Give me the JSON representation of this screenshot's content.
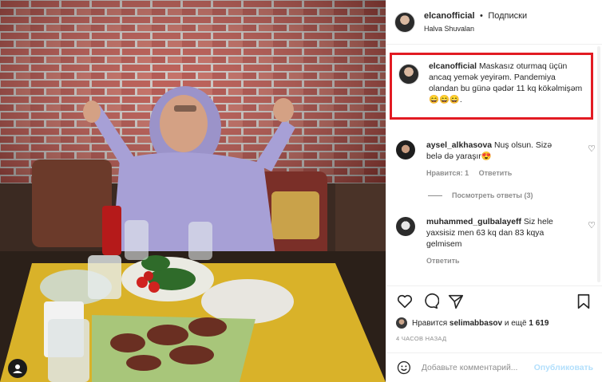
{
  "post": {
    "username": "elcanofficial",
    "separator": "•",
    "follow_label": "Подписки",
    "location": "Halva Shuvalan"
  },
  "caption": {
    "username": "elcanofficial",
    "text": "Maskasız oturmaq üçün ancaq yemək yeyirəm. Pandemiya olandan bu günə qədər 11 kq kökəlmişəm😄😄😄."
  },
  "comments": [
    {
      "username": "aysel_alkhasova",
      "text": "Nuş olsun. Sizə belə də yaraşır😍",
      "likes": "Нравится: 1",
      "reply": "Ответить",
      "view_replies": "Посмотреть ответы (3)"
    },
    {
      "username": "muhammed_gulbalayeff",
      "text": "Siz hele yaxsisiz men 63 kq dan 83 kqya gelmisem",
      "reply": "Ответить"
    }
  ],
  "likes": {
    "prefix": "Нравится",
    "user": "selimabbasov",
    "middle": "и ещё",
    "count": "1 619"
  },
  "timestamp": "4 ЧАСОВ НАЗАД",
  "comment_box": {
    "placeholder": "Добавьте комментарий...",
    "publish_label": "Опубликовать"
  }
}
